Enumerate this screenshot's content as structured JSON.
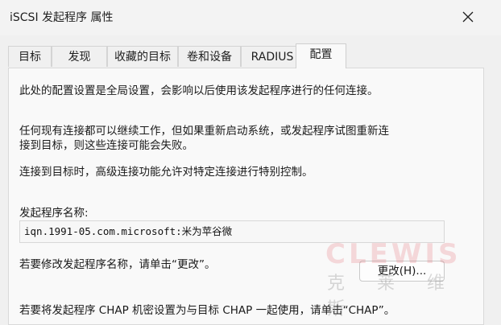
{
  "window": {
    "title": "iSCSI 发起程序 属性"
  },
  "tabs": [
    {
      "label": "目标"
    },
    {
      "label": "发现"
    },
    {
      "label": "收藏的目标"
    },
    {
      "label": "卷和设备"
    },
    {
      "label": "RADIUS"
    },
    {
      "label": "配置"
    }
  ],
  "config": {
    "p1": "此处的配置设置是全局设置，会影响以后使用该发起程序进行的任何连接。",
    "p2_line1": "任何现有连接都可以继续工作，但如果重新启动系统，或发起程序试图重新连",
    "p2_line2": "接到目标，则这些连接可能会失败。",
    "p3": "连接到目标时，高级连接功能允许对特定连接进行特别控制。",
    "name_label": "发起程序名称:",
    "name_value": "iqn.1991-05.com.microsoft:米为苹谷微",
    "change_hint": "若要修改发起程序名称，请单击“更改”。",
    "change_button": "更改(H)...",
    "bottom_line": "若要将发起程序 CHAP 机密设置为与目标 CHAP 一起使用，请单击“CHAP”。"
  },
  "watermark": {
    "en": "CLEWIS",
    "cn": "克莱维斯"
  }
}
